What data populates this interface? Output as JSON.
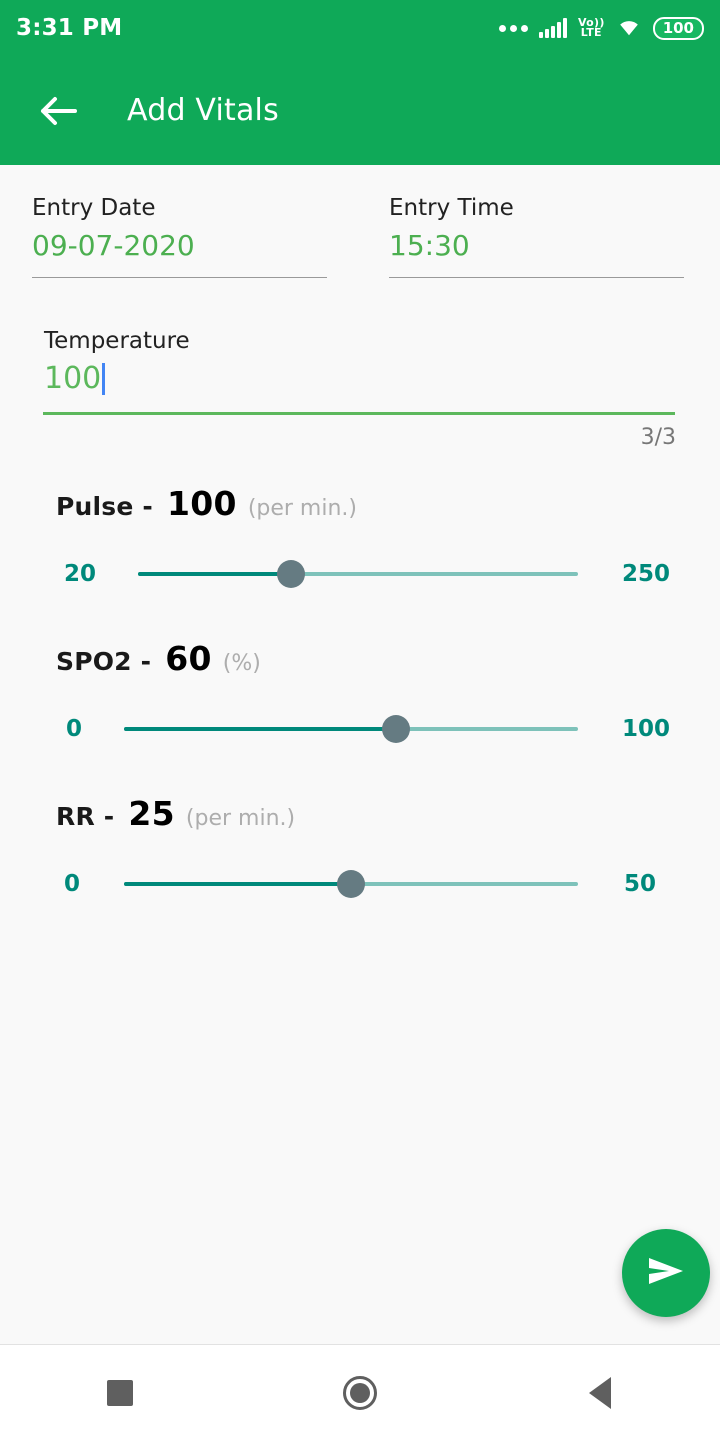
{
  "status_bar": {
    "time": "3:31 PM",
    "network_label_top": "Vo))",
    "network_label_bottom": "LTE",
    "battery": "100",
    "icons": [
      "more-dots-icon",
      "signal-bars-icon",
      "volte-icon",
      "wifi-icon",
      "battery-icon"
    ]
  },
  "app_bar": {
    "back_icon": "back-arrow-icon",
    "title": "Add Vitals"
  },
  "form": {
    "entry_date": {
      "label": "Entry Date",
      "value": "09-07-2020"
    },
    "entry_time": {
      "label": "Entry Time",
      "value": "15:30"
    },
    "temperature": {
      "label": "Temperature",
      "value": "100",
      "counter": "3/3"
    }
  },
  "vitals": [
    {
      "name": "Pulse -",
      "value": "100",
      "unit": "(per min.)",
      "min_label": "20",
      "max_label": "250",
      "min": 20,
      "max": 250,
      "current": 100,
      "percent": 34.8
    },
    {
      "name": "SPO2 -",
      "value": "60",
      "unit": "(%)",
      "min_label": "0",
      "max_label": "100",
      "min": 0,
      "max": 100,
      "current": 60,
      "percent": 60
    },
    {
      "name": "RR -",
      "value": "25",
      "unit": "(per min.)",
      "min_label": "0",
      "max_label": "50",
      "min": 0,
      "max": 50,
      "current": 25,
      "percent": 50
    }
  ],
  "fab": {
    "icon": "send-icon"
  },
  "nav_bar": {
    "recents_icon": "square-recents-icon",
    "home_icon": "circle-home-icon",
    "back_icon": "triangle-back-icon"
  },
  "colors": {
    "primary_green": "#0fa958",
    "accent_green": "#4caf50",
    "input_green": "#5cb85c",
    "teal": "#00897b",
    "teal_light": "#7ec2ba",
    "thumb": "#657b82",
    "caret_blue": "#4285f4",
    "background": "#f9f9f9"
  }
}
